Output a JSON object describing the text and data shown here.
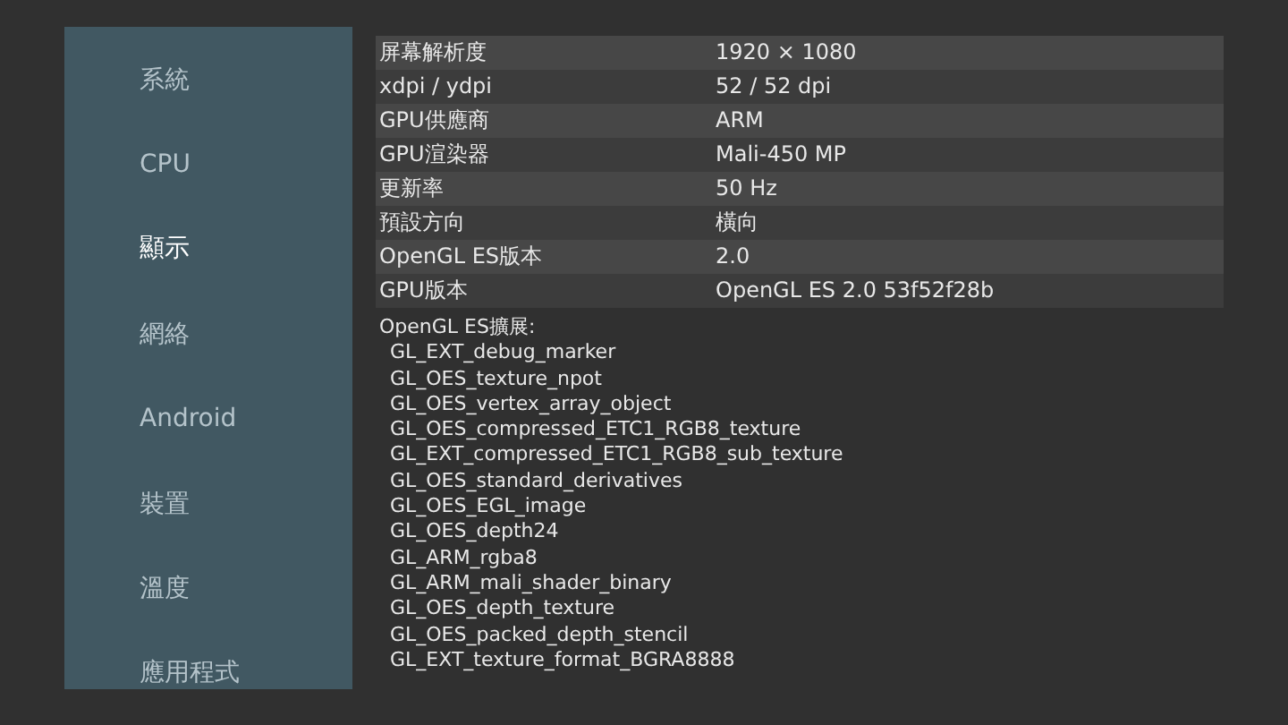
{
  "sidebar": {
    "items": [
      {
        "label": "系統",
        "selected": false
      },
      {
        "label": "CPU",
        "selected": false
      },
      {
        "label": "顯示",
        "selected": true
      },
      {
        "label": "網絡",
        "selected": false
      },
      {
        "label": "Android",
        "selected": false
      },
      {
        "label": "裝置",
        "selected": false
      },
      {
        "label": "溫度",
        "selected": false
      },
      {
        "label": "應用程式",
        "selected": false
      }
    ]
  },
  "table": {
    "rows": [
      {
        "label": "屏幕解析度",
        "value": "1920 × 1080"
      },
      {
        "label": "xdpi / ydpi",
        "value": "52 / 52 dpi"
      },
      {
        "label": "GPU供應商",
        "value": "ARM"
      },
      {
        "label": "GPU渲染器",
        "value": "Mali-450 MP"
      },
      {
        "label": "更新率",
        "value": "50 Hz"
      },
      {
        "label": "預設方向",
        "value": "橫向"
      },
      {
        "label": "OpenGL ES版本",
        "value": "2.0"
      },
      {
        "label": "GPU版本",
        "value": "OpenGL ES 2.0 53f52f28b"
      }
    ]
  },
  "extensions": {
    "heading": "OpenGL ES擴展:",
    "items": [
      "GL_EXT_debug_marker",
      "GL_OES_texture_npot",
      "GL_OES_vertex_array_object",
      "GL_OES_compressed_ETC1_RGB8_texture",
      "GL_EXT_compressed_ETC1_RGB8_sub_texture",
      "GL_OES_standard_derivatives",
      "GL_OES_EGL_image",
      "GL_OES_depth24",
      "GL_ARM_rgba8",
      "GL_ARM_mali_shader_binary",
      "GL_OES_depth_texture",
      "GL_OES_packed_depth_stencil",
      "GL_EXT_texture_format_BGRA8888"
    ]
  }
}
